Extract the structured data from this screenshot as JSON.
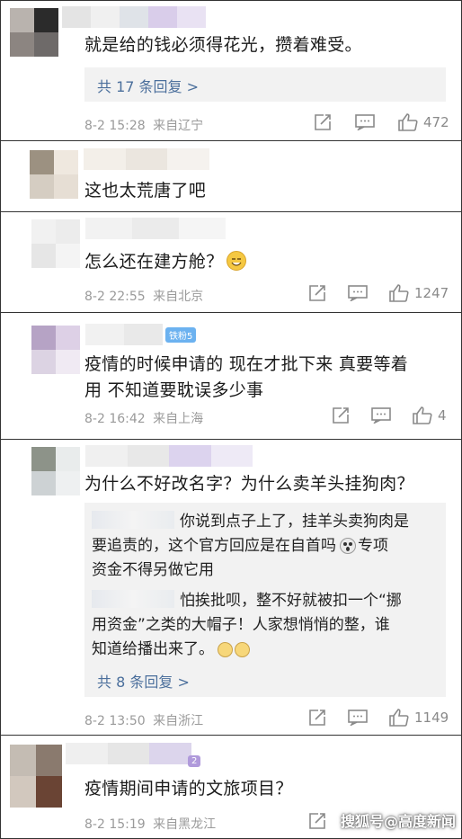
{
  "comments": [
    {
      "text": "就是给的钱必须得花光，攒着难受。",
      "replies_link": "共 17 条回复 >",
      "date": "8-2 15:28",
      "location": "来自辽宁",
      "likes": "472"
    },
    {
      "text": "这也太荒唐了吧"
    },
    {
      "text": "怎么还在建方舱？",
      "date": "8-2 22:55",
      "location": "来自北京",
      "likes": "1247"
    },
    {
      "badge": "铁粉5",
      "text_line1": "疫情的时候申请的  现在才批下来  真要等着",
      "text_line2": "用  不知道要耽误多少事",
      "date": "8-2 16:42",
      "location": "来自上海",
      "likes": "4"
    },
    {
      "text": "为什么不好改名字？为什么卖羊头挂狗肉？",
      "reply1_line1": "你说到点子上了，挂羊头卖狗肉是",
      "reply1_line2": "要追责的，这个官方回应是在自首吗",
      "reply1_line2b": "专项",
      "reply1_line3": "资金不得另做它用",
      "reply2_line1": "怕挨批呗，整不好就被扣一个“挪",
      "reply2_line2": "用资金”之类的大帽子！人家想悄悄的整，谁",
      "reply2_line3": "知道给播出来了。",
      "replies_link": "共 8 条回复 >",
      "date": "8-2 13:50",
      "location": "来自浙江",
      "likes": "1149"
    },
    {
      "badge_digit": "2",
      "text": "疫情期间申请的文旅项目？",
      "date": "8-2 15:19",
      "location": "来自黑龙江"
    }
  ],
  "watermark": "搜狐号@高度新闻",
  "icons": [
    "repost-icon",
    "comment-icon",
    "like-icon",
    "emoji-icon"
  ],
  "colors": {
    "link": "#4b6f9c",
    "meta": "#9a9a9a",
    "badge": "#6cb2f0"
  }
}
